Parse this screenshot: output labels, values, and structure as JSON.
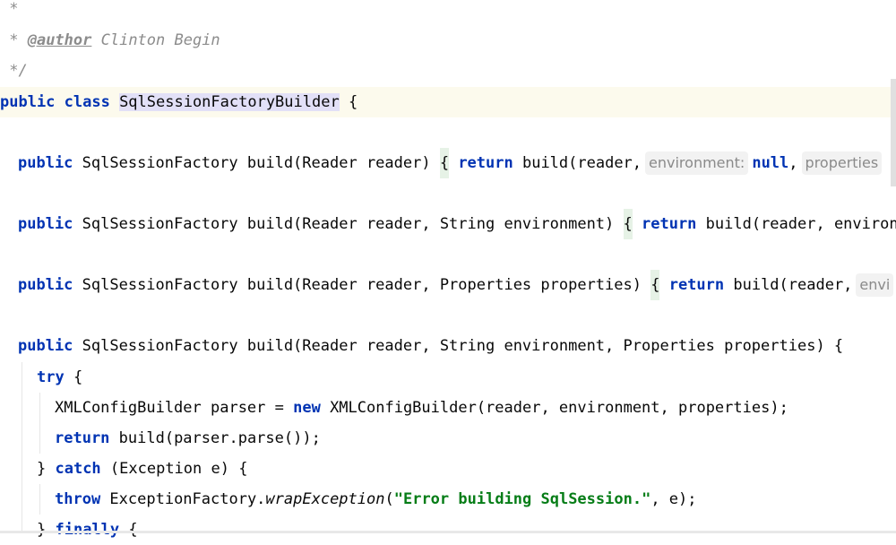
{
  "code": {
    "l1_comment": " *",
    "l2_star": " * ",
    "l2_tag": "@author",
    "l2_name": " Clinton Begin",
    "l3_comment": " */",
    "l4_kw": "public class ",
    "l4_name": "SqlSessionFactoryBuilder",
    "l4_rest": " {",
    "m1_kw": "public",
    "m1_sig": " SqlSessionFactory build(Reader reader) ",
    "m1_brace": "{",
    "m1_return": " return",
    "m1_call": " build(reader,",
    "m1_hint1": "environment:",
    "m1_null": "null",
    "m1_comma": ",",
    "m1_hint2": "properties",
    "m2_kw": "public",
    "m2_sig": " SqlSessionFactory build(Reader reader, String environment) ",
    "m2_brace": "{",
    "m2_return": " return",
    "m2_call": " build(reader, environm",
    "m3_kw": "public",
    "m3_sig": " SqlSessionFactory build(Reader reader, Properties properties) ",
    "m3_brace": "{",
    "m3_return": " return",
    "m3_call": " build(reader,",
    "m3_hint": "envi",
    "m4_kw": "public",
    "m4_sig": " SqlSessionFactory build(Reader reader, String environment, Properties properties) {",
    "try_kw": "try",
    "try_rest": " {",
    "parser_a": "XMLConfigBuilder parser = ",
    "parser_new": "new",
    "parser_b": " XMLConfigBuilder(reader, environment, properties);",
    "ret_kw": "return",
    "ret_rest": " build(parser.parse());",
    "catch_a": "} ",
    "catch_kw": "catch",
    "catch_rest": " (Exception e) {",
    "throw_kw": "throw",
    "throw_a": " ExceptionFactory.",
    "throw_method": "wrapException",
    "throw_b": "(",
    "throw_str": "\"Error building SqlSession.\"",
    "throw_c": ", e);",
    "finally_a": "} ",
    "finally_kw": "finally",
    "finally_rest": " {"
  }
}
